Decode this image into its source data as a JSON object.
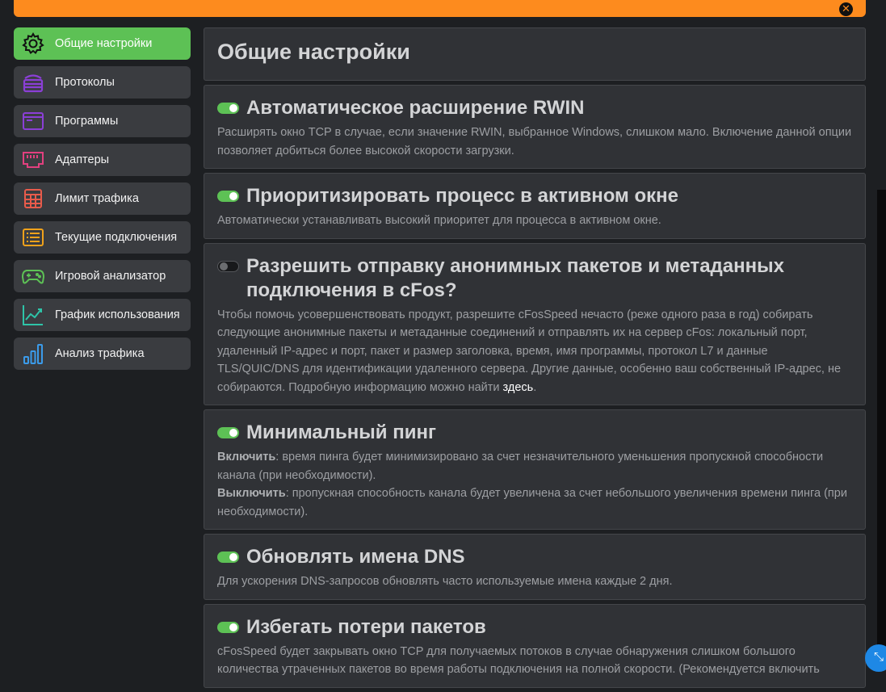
{
  "sidebar": {
    "items": [
      {
        "label": "Общие настройки"
      },
      {
        "label": "Протоколы"
      },
      {
        "label": "Программы"
      },
      {
        "label": "Адаптеры"
      },
      {
        "label": "Лимит трафика"
      },
      {
        "label": "Текущие подключения"
      },
      {
        "label": "Игровой анализатор"
      },
      {
        "label": "График использования"
      },
      {
        "label": "Анализ трафика"
      }
    ]
  },
  "page": {
    "title": "Общие настройки"
  },
  "settings": [
    {
      "title": "Автоматическое расширение RWIN",
      "enabled": true,
      "desc": "Расширять окно TCP в случае, если значение RWIN, выбранное Windows, слишком мало. Включение данной опции позволяет добиться более высокой скорости загрузки."
    },
    {
      "title": "Приоритизировать процесс в активном окне",
      "enabled": true,
      "desc": "Автоматически устанавливать высокий приоритет для процесса в активном окне."
    },
    {
      "title": "Разрешить отправку анонимных пакетов и метаданных подключения в cFos?",
      "enabled": false,
      "desc": "Чтобы помочь усовершенствовать продукт, разрешите cFosSpeed нечасто (реже одного раза в год) собирать следующие анонимные пакеты и метаданные соединений и отправлять их на сервер cFos: локальный порт, удаленный IP-адрес и порт, пакет и размер заголовка, время, имя программы, протокол L7 и данные TLS/QUIC/DNS для идентификации удаленного сервера. Другие данные, особенно ваш собственный IP-адрес, не собираются. Подробную информацию можно найти ",
      "link": "здесь",
      "after_link": "."
    },
    {
      "title": "Минимальный пинг",
      "enabled": true,
      "on_label": "Включить",
      "on_desc": ": время пинга будет минимизировано за счет незначительного уменьшения пропускной способности канала (при необходимости).",
      "off_label": "Выключить",
      "off_desc": ": пропускная способность канала будет увеличена за счет небольшого увеличения времени пинга (при необходимости)."
    },
    {
      "title": "Обновлять имена DNS",
      "enabled": true,
      "desc": "Для ускорения DNS-запросов обновлять часто используемые имена каждые 2 дня."
    },
    {
      "title": "Избегать потери пакетов",
      "enabled": true,
      "desc": "cFosSpeed будет закрывать окно TCP для получаемых потоков в случае обнаружения слишком большого количества утраченных пакетов во время работы подключения на полной скорости. (Рекомендуется включить"
    }
  ],
  "icons": {
    "close": "close-icon",
    "resize": "expand-icon"
  },
  "colors": {
    "accent_orange": "#fd8b1e",
    "active_green": "#5dc155",
    "panel": "#303236"
  }
}
